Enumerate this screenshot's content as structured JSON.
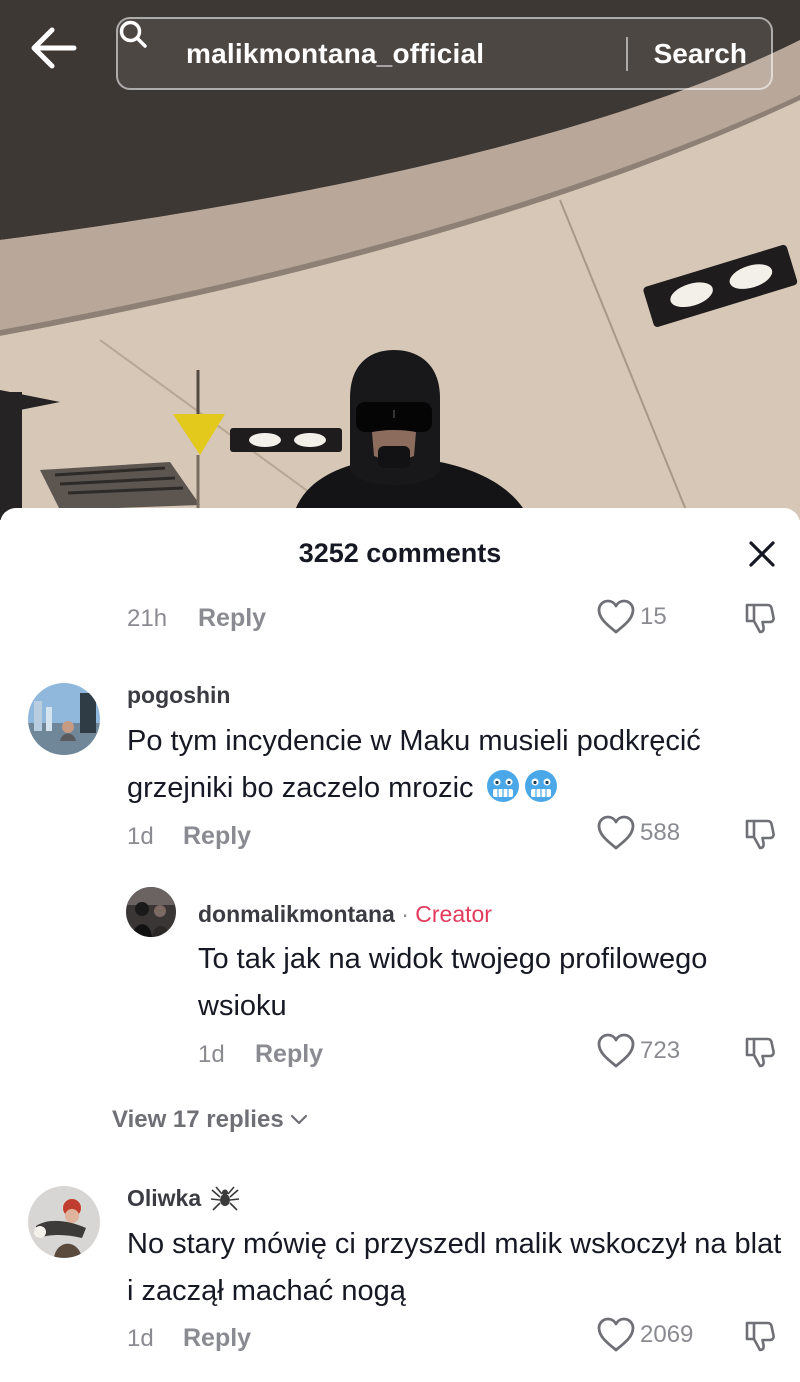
{
  "search": {
    "query": "malikmontana_official",
    "button_label": "Search"
  },
  "icons": {
    "back": "arrow-left-icon",
    "search": "magnifier-icon",
    "close": "close-icon",
    "like": "heart-outline-icon",
    "dislike": "thumbs-down-icon",
    "chevron": "chevron-down-icon"
  },
  "comments_sheet": {
    "title": "3252 comments",
    "previous_comment": {
      "time": "21h",
      "reply_label": "Reply",
      "likes": "15"
    },
    "comments": [
      {
        "username": "pogoshin",
        "text": "Po tym incydencie w Maku musieli podkręcić grzejniki bo zaczelo mrozic",
        "emojis": [
          "cold-face-emoji",
          "cold-face-emoji"
        ],
        "time": "1d",
        "reply_label": "Reply",
        "likes": "588"
      },
      {
        "username": "donmalikmontana",
        "separator": "·",
        "badge": "Creator",
        "text": "To tak jak na widok twojego profilowego wsioku",
        "time": "1d",
        "reply_label": "Reply",
        "likes": "723"
      },
      {
        "username": "Oliwka",
        "username_emoji": "spider-emoji",
        "text": "No stary mówię ci przyszedl malik wskoczył na blat i zaczął machać nogą",
        "time": "1d",
        "reply_label": "Reply",
        "likes": "2069"
      }
    ],
    "view_replies_label": "View 17 replies"
  },
  "colors": {
    "text_primary": "#161823",
    "text_secondary": "#8a8b91",
    "creator_badge": "#e33a5c"
  }
}
